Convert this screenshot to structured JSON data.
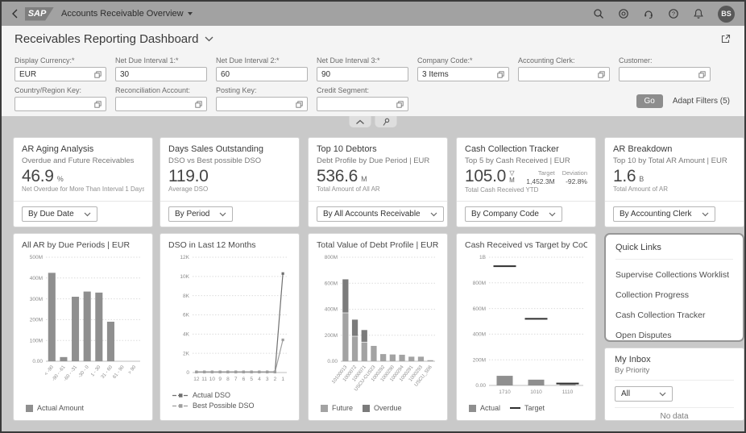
{
  "shell": {
    "logo": "SAP",
    "title": "Accounts Receivable Overview",
    "avatar": "BS"
  },
  "page": {
    "title": "Receivables Reporting Dashboard"
  },
  "filters": {
    "row1": [
      {
        "label": "Display Currency:*",
        "value": "EUR",
        "help": true
      },
      {
        "label": "Net Due Interval 1:*",
        "value": "30",
        "help": false
      },
      {
        "label": "Net Due Interval 2:*",
        "value": "60",
        "help": false
      },
      {
        "label": "Net Due Interval 3:*",
        "value": "90",
        "help": false
      },
      {
        "label": "Company Code:*",
        "value": "3 Items",
        "help": true
      },
      {
        "label": "Accounting Clerk:",
        "value": "",
        "help": true
      },
      {
        "label": "Customer:",
        "value": "",
        "help": true
      }
    ],
    "row2": [
      {
        "label": "Country/Region Key:",
        "value": "",
        "help": true
      },
      {
        "label": "Reconciliation Account:",
        "value": "",
        "help": true
      },
      {
        "label": "Posting Key:",
        "value": "",
        "help": true
      },
      {
        "label": "Credit Segment:",
        "value": "",
        "help": true
      }
    ],
    "go_label": "Go",
    "adapt_label": "Adapt Filters (5)"
  },
  "kpi_cards": [
    {
      "title": "AR Aging Analysis",
      "subtitle": "Overdue and Future Receivables",
      "value": "46.9",
      "unit": "%",
      "caption": "Net Overdue for More Than Interval 1 Days",
      "dropdown": "By Due Date"
    },
    {
      "title": "Days Sales Outstanding",
      "subtitle": "DSO vs Best possible DSO",
      "value": "119.0",
      "unit": "",
      "caption": "Average DSO",
      "dropdown": "By Period"
    },
    {
      "title": "Top 10 Debtors",
      "subtitle": "Debt Profile by Due Period | EUR",
      "value": "536.6",
      "unit": "M",
      "caption": "Total Amount of All AR",
      "dropdown": "By All Accounts Receivable"
    },
    {
      "title": "Cash Collection Tracker",
      "subtitle": "Top 5 by Cash Received | EUR",
      "value": "105.0",
      "unit": "M",
      "indicator": "▽",
      "target_label": "Target",
      "target_value": "1,452.3M",
      "deviation_label": "Deviation",
      "deviation_value": "-92.8%",
      "caption": "Total Cash Received YTD",
      "dropdown": "By Company Code"
    },
    {
      "title": "AR Breakdown",
      "subtitle": "Top 10 by Total AR Amount | EUR",
      "value": "1.6",
      "unit": "B",
      "caption": "Total Amount of AR",
      "dropdown": "By Accounting Clerk"
    }
  ],
  "chart_data": [
    {
      "type": "bar",
      "title": "All AR by Due Periods | EUR",
      "categories": [
        "< -90",
        "-90 - -61",
        "-60 - -31",
        "-30 - 0",
        "1 - 30",
        "31 - 60",
        "61 - 90",
        "> 90"
      ],
      "values": [
        425,
        20,
        310,
        335,
        330,
        190,
        0,
        0
      ],
      "unit": "M EUR",
      "ylim": [
        0,
        500
      ],
      "y_ticks": [
        0,
        100,
        200,
        300,
        400,
        500
      ],
      "y_tick_labels": [
        "0.00",
        "100M",
        "200M",
        "300M",
        "400M",
        "500M"
      ],
      "rotate_x": true,
      "legend": [
        {
          "label": "Actual Amount",
          "swatch": "square",
          "color": "#8f8f8f"
        }
      ]
    },
    {
      "type": "line",
      "title": "DSO in Last 12 Months",
      "x": [
        "12",
        "11",
        "10",
        "9",
        "8",
        "7",
        "6",
        "5",
        "4",
        "3",
        "2",
        "1"
      ],
      "series": [
        {
          "name": "Actual DSO",
          "values": [
            60,
            60,
            60,
            60,
            60,
            60,
            60,
            60,
            60,
            60,
            60,
            10300
          ]
        },
        {
          "name": "Best Possible DSO",
          "values": [
            45,
            45,
            45,
            45,
            45,
            45,
            45,
            45,
            45,
            45,
            45,
            3400
          ]
        }
      ],
      "ylim": [
        0,
        12000
      ],
      "y_ticks": [
        0,
        2000,
        4000,
        6000,
        8000,
        10000,
        12000
      ],
      "y_tick_labels": [
        "0",
        "2K",
        "4K",
        "6K",
        "8K",
        "10K",
        "12K"
      ],
      "legend_vertical": true,
      "legend": [
        {
          "label": "Actual DSO",
          "swatch": "linedot",
          "color": "#6f6f6f"
        },
        {
          "label": "Best Possible DSO",
          "swatch": "linedot",
          "color": "#9e9e9e"
        }
      ]
    },
    {
      "type": "stacked_bar",
      "title": "Total Value of Debt Profile | EUR",
      "categories": [
        "10100013",
        "1000072",
        "1000071",
        "USCU-CUS23",
        "1000292",
        "1000290",
        "1000294",
        "1000291",
        "1000293",
        "USCU_S06"
      ],
      "series": [
        {
          "name": "Future",
          "values": [
            370,
            190,
            145,
            118,
            55,
            52,
            50,
            35,
            35,
            8
          ]
        },
        {
          "name": "Overdue",
          "values": [
            260,
            130,
            95,
            0,
            0,
            0,
            0,
            0,
            0,
            0
          ]
        }
      ],
      "ylim": [
        0,
        800
      ],
      "y_ticks": [
        0,
        200,
        400,
        600,
        800
      ],
      "y_tick_labels": [
        "0.00",
        "200M",
        "400M",
        "600M",
        "800M"
      ],
      "rotate_x": true,
      "legend": [
        {
          "label": "Future",
          "swatch": "square",
          "color": "#a3a3a3"
        },
        {
          "label": "Overdue",
          "swatch": "square",
          "color": "#7b7b7b"
        }
      ]
    },
    {
      "type": "bar_target",
      "title": "Cash Received vs Target by CoCd. | EUR",
      "categories": [
        "1710",
        "1010",
        "1110"
      ],
      "series": [
        {
          "name": "Actual",
          "values": [
            75,
            45,
            8
          ]
        },
        {
          "name": "Target",
          "values": [
            930,
            520,
            15
          ]
        }
      ],
      "ylim": [
        0,
        1000
      ],
      "y_ticks": [
        0,
        200,
        400,
        600,
        800,
        1000
      ],
      "y_tick_labels": [
        "0.00",
        "200M",
        "400M",
        "600M",
        "800M",
        "1B"
      ],
      "legend": [
        {
          "label": "Actual",
          "swatch": "square",
          "color": "#8f8f8f"
        },
        {
          "label": "Target",
          "swatch": "dash",
          "color": "#2f2f2f"
        }
      ]
    }
  ],
  "quick_links": {
    "title": "Quick Links",
    "links": [
      "Supervise Collections Worklist",
      "Collection Progress",
      "Cash Collection Tracker",
      "Open Disputes"
    ]
  },
  "my_inbox": {
    "title": "My Inbox",
    "subtitle": "By Priority",
    "dropdown": "All",
    "empty": "No data"
  }
}
